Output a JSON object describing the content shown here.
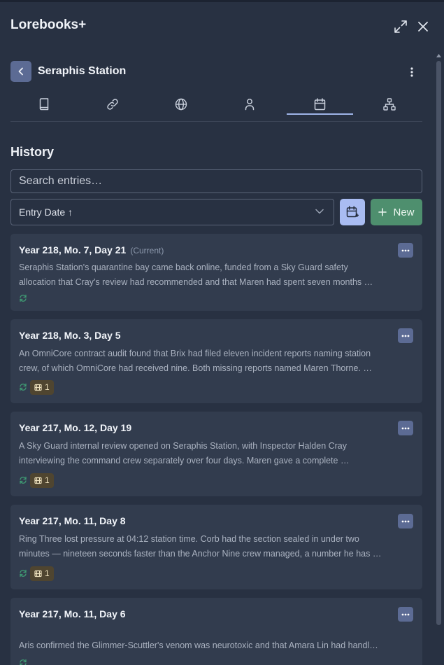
{
  "app": {
    "title": "Lorebooks+"
  },
  "header": {
    "book_title": "Seraphis Station"
  },
  "tabs": [
    {
      "icon": "book-icon"
    },
    {
      "icon": "link-icon"
    },
    {
      "icon": "globe-icon"
    },
    {
      "icon": "person-icon"
    },
    {
      "icon": "calendar-icon",
      "active": true
    },
    {
      "icon": "hierarchy-icon"
    }
  ],
  "section": {
    "title": "History"
  },
  "search": {
    "placeholder": "Search entries…"
  },
  "sort": {
    "label": "Entry Date",
    "direction": "↑"
  },
  "new_button": {
    "label": "New"
  },
  "colors": {
    "accent": "#a9bcf2",
    "new_button": "#4e8f6e",
    "back_button": "#5c6b94",
    "card_bg": "#323c4e",
    "badge_bg": "#4f4530"
  },
  "entries": [
    {
      "date": "Year 218, Mo. 7, Day 21",
      "tag": "(Current)",
      "line1": "Seraphis Station's quarantine bay came back online, funded from a Sky Guard safety",
      "line2": "allocation that Cray's review had recommended and that Maren had spent seven months …",
      "links": ""
    },
    {
      "date": "Year 218, Mo. 3, Day 5",
      "tag": "",
      "line1": "An OmniCore contract audit found that Brix had filed eleven incident reports naming station",
      "line2": "crew, of which OmniCore had received nine. Both missing reports named Maren Thorne. …",
      "links": "1"
    },
    {
      "date": "Year 217, Mo. 12, Day 19",
      "tag": "",
      "line1": "A Sky Guard internal review opened on Seraphis Station, with Inspector Halden Cray",
      "line2": "interviewing the command crew separately over four days. Maren gave a complete …",
      "links": "1"
    },
    {
      "date": "Year 217, Mo. 11, Day 8",
      "tag": "",
      "line1": "Ring Three lost pressure at 04:12 station time. Corb had the section sealed in under two",
      "line2": "minutes — nineteen seconds faster than the Anchor Nine crew managed, a number he has …",
      "links": "1"
    },
    {
      "date": "Year 217, Mo. 11, Day 6",
      "tag": "",
      "line1": "",
      "line2": "Aris confirmed the Glimmer-Scuttler's venom was neurotoxic and that Amara Lin had handl…",
      "links": ""
    }
  ]
}
